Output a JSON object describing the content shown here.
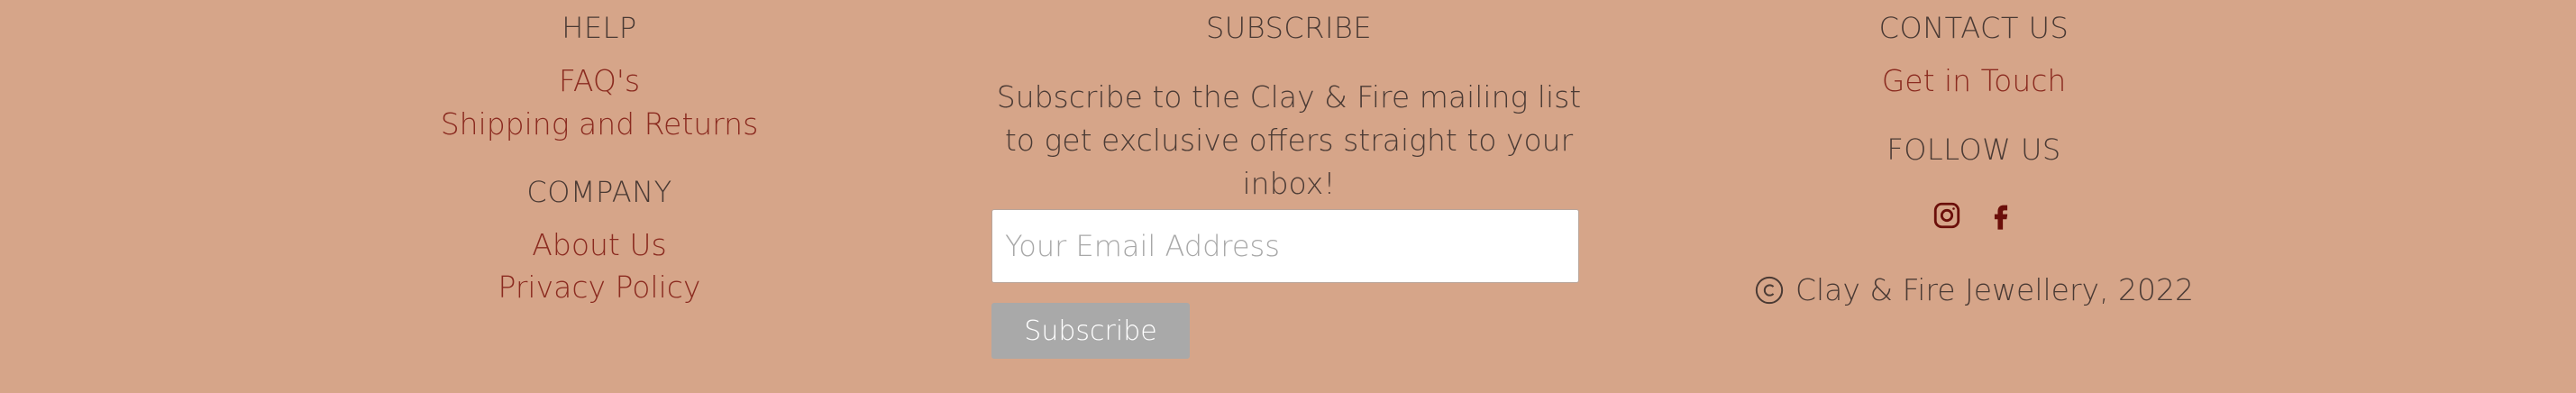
{
  "help": {
    "heading": "HELP",
    "links": [
      "FAQ's",
      "Shipping and Returns"
    ]
  },
  "company": {
    "heading": "COMPANY",
    "links": [
      "About Us",
      "Privacy Policy"
    ]
  },
  "subscribe": {
    "heading": "SUBSCRIBE",
    "text": "Subscribe to the Clay & Fire mailing list to get exclusive offers straight to your inbox!",
    "email_placeholder": "Your Email Address",
    "button_label": "Subscribe"
  },
  "contact": {
    "heading": "CONTACT US",
    "link": "Get in Touch"
  },
  "follow": {
    "heading": "FOLLOW US",
    "icons": [
      "instagram-icon",
      "facebook-icon"
    ]
  },
  "copyright": {
    "text": "Clay & Fire Jewellery, 2022",
    "icon": "copyright-icon"
  },
  "colors": {
    "background": "#d6a589",
    "link": "#8b2b20",
    "heading": "#4a3a34",
    "button": "#a9a9a9",
    "social_icon": "#6b0f0a"
  }
}
